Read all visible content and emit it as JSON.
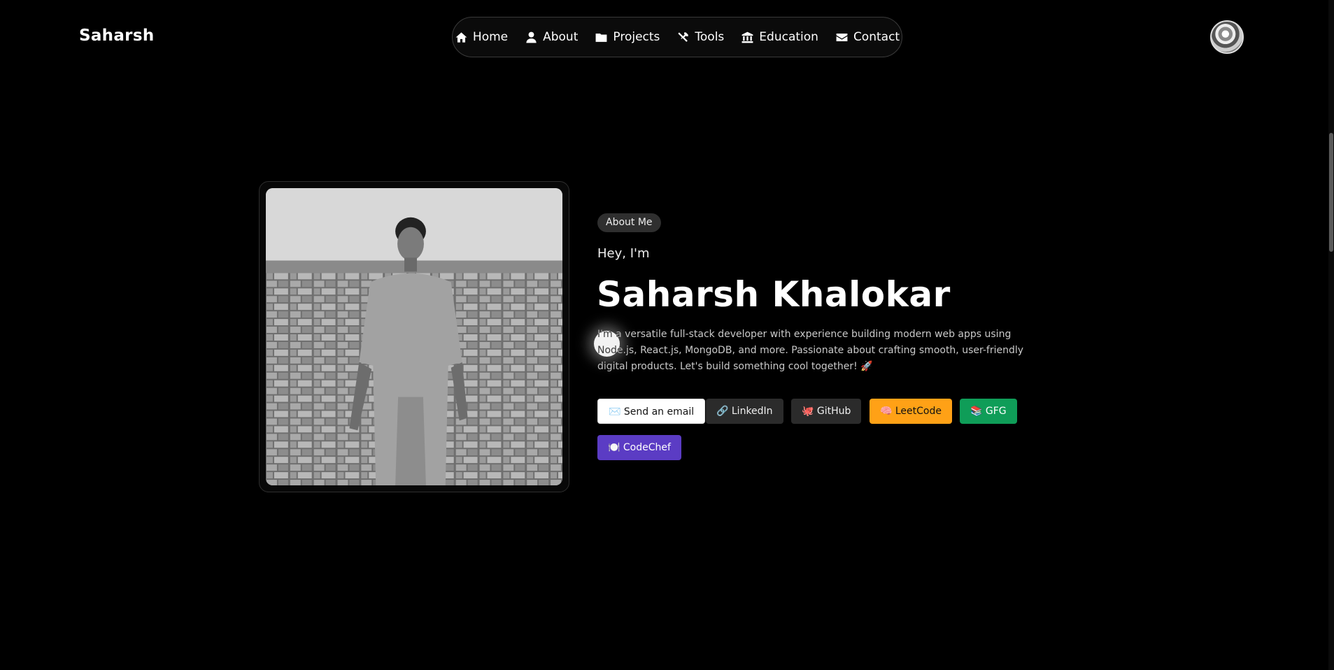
{
  "header": {
    "brand": "Saharsh",
    "nav": [
      {
        "label": "Home",
        "icon": "home-icon"
      },
      {
        "label": "About",
        "icon": "user-icon"
      },
      {
        "label": "Projects",
        "icon": "folder-icon"
      },
      {
        "label": "Tools",
        "icon": "tools-icon"
      },
      {
        "label": "Education",
        "icon": "institution-icon"
      },
      {
        "label": "Contact",
        "icon": "envelope-icon"
      }
    ]
  },
  "about": {
    "badge": "About Me",
    "greeting": "Hey, I'm",
    "name": "Saharsh Khalokar",
    "bio": "I'm a versatile full-stack developer with experience building modern web apps using Node.js, React.js, MongoDB, and more. Passionate about crafting smooth, user-friendly digital products. Let's build something cool together! 🚀",
    "buttons": {
      "email": "✉️ Send an email",
      "linkedin": "🔗 LinkedIn",
      "github": "🐙 GitHub",
      "leetcode": "🧠 LeetCode",
      "gfg": "📚 GFG",
      "codechef": "🍽️ CodeChef"
    }
  },
  "colors": {
    "background": "#000000",
    "leetcode": "#ffa116",
    "gfg": "#0f9d58",
    "codechef": "#5b3cc4"
  }
}
